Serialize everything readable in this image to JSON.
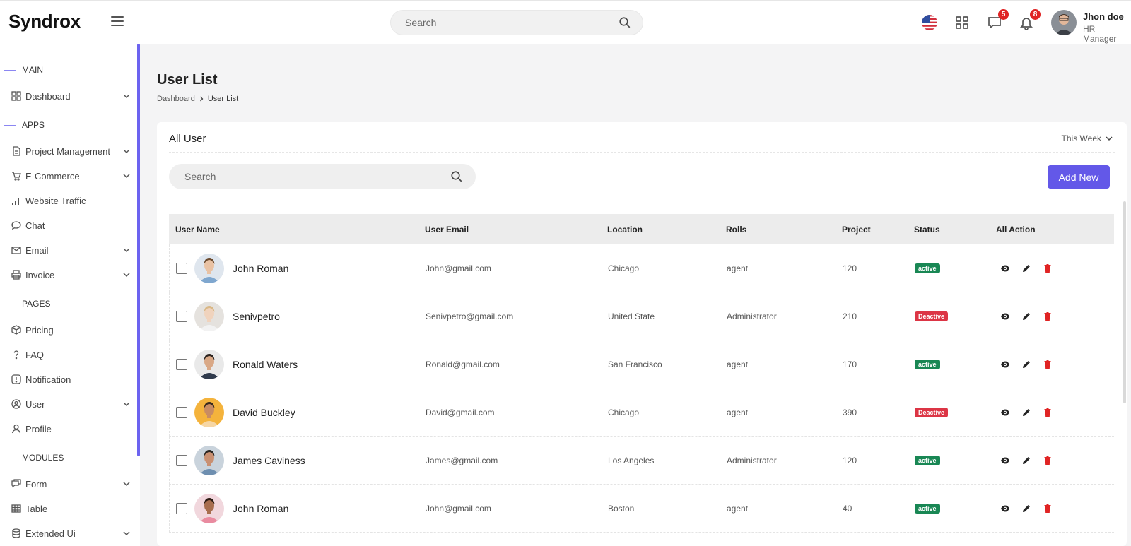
{
  "app": {
    "logo": "Syndrox"
  },
  "topbar": {
    "search_placeholder": "Search",
    "messages_count": "5",
    "notifications_count": "8",
    "user_name": "Jhon doe",
    "user_role": "HR Manager"
  },
  "sidebar": {
    "sections": {
      "main": "MAIN",
      "apps": "APPS",
      "pages": "PAGES",
      "modules": "MODULES"
    },
    "items": {
      "dashboard": "Dashboard",
      "project_management": "Project Management",
      "ecommerce": "E-Commerce",
      "website_traffic": "Website Traffic",
      "chat": "Chat",
      "email": "Email",
      "invoice": "Invoice",
      "pricing": "Pricing",
      "faq": "FAQ",
      "notification": "Notification",
      "user": "User",
      "profile": "Profile",
      "form": "Form",
      "table": "Table",
      "extended_ui": "Extended Ui"
    }
  },
  "page": {
    "title": "User List",
    "breadcrumb": {
      "parent": "Dashboard",
      "current": "User List"
    }
  },
  "card": {
    "title": "All User",
    "filter": "This Week",
    "search_placeholder": "Search",
    "add_button": "Add New"
  },
  "table": {
    "headers": {
      "user_name": "User Name",
      "email": "User Email",
      "location": "Location",
      "rolls": "Rolls",
      "project": "Project",
      "status": "Status",
      "action": "All Action"
    },
    "rows": [
      {
        "name": "John Roman",
        "email": "John@gmail.com",
        "location": "Chicago",
        "role": "agent",
        "project": "120",
        "status": "active"
      },
      {
        "name": "Senivpetro",
        "email": "Senivpetro@gmail.com",
        "location": "United State",
        "role": "Administrator",
        "project": "210",
        "status": "Deactive"
      },
      {
        "name": "Ronald Waters",
        "email": "Ronald@gmail.com",
        "location": "San Francisco",
        "role": "agent",
        "project": "170",
        "status": "active"
      },
      {
        "name": "David Buckley",
        "email": "David@gmail.com",
        "location": "Chicago",
        "role": "agent",
        "project": "390",
        "status": "Deactive"
      },
      {
        "name": "James Caviness",
        "email": "James@gmail.com",
        "location": "Los Angeles",
        "role": "Administrator",
        "project": "120",
        "status": "active"
      },
      {
        "name": "John Roman",
        "email": "John@gmail.com",
        "location": "Boston",
        "role": "agent",
        "project": "40",
        "status": "active"
      }
    ]
  },
  "colors": {
    "accent": "#6358e8",
    "active": "#198754",
    "deactive": "#dc3545",
    "badge": "#e02424",
    "delete": "#e02424"
  }
}
